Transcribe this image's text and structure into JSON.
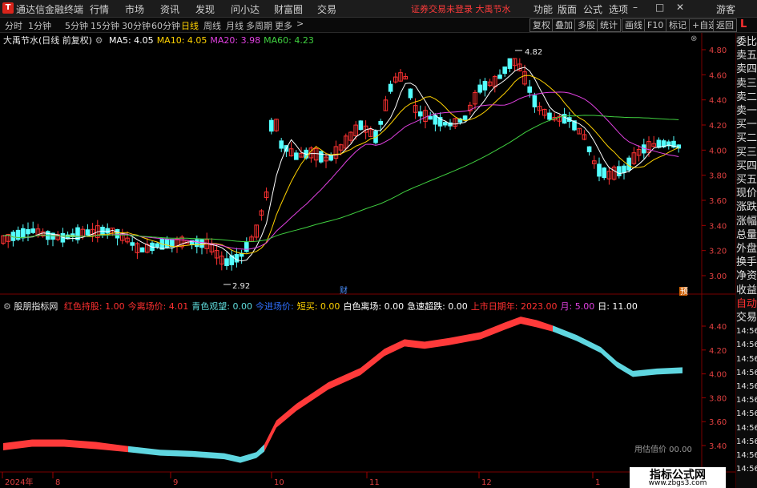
{
  "menubar": {
    "app_title": "通达信金融终端",
    "logo_glyph": "T",
    "items": [
      "行情",
      "市场",
      "资讯",
      "发现",
      "问小达",
      "财富圈",
      "交易"
    ],
    "notice": "证券交易未登录  大禹节水",
    "right_items": [
      "功能",
      "版面",
      "公式",
      "选项",
      "游客"
    ],
    "window_controls": [
      "minimize-icon",
      "maximize-icon",
      "close-icon"
    ]
  },
  "toolbar": {
    "periods": [
      "分时",
      "1分钟",
      "5分钟",
      "15分钟",
      "30分钟",
      "60分钟",
      "日线",
      "周线",
      "月线",
      "多周期",
      "更多"
    ],
    "active_period": "日线",
    "right_buttons": [
      "复权",
      "叠加",
      "多股",
      "统计",
      "画线",
      "F10",
      "标记",
      "+自选",
      "返回"
    ]
  },
  "main_chart": {
    "title": "大禹节水(日线 前复权)",
    "ma_legend": [
      {
        "label": "MA5: 4.05",
        "color": "#ffffff"
      },
      {
        "label": "MA10: 4.05",
        "color": "#ffd200"
      },
      {
        "label": "MA20: 3.98",
        "color": "#e040e0"
      },
      {
        "label": "MA60: 4.23",
        "color": "#40d040"
      }
    ],
    "y_ticks": [
      "4.80",
      "4.60",
      "4.40",
      "4.20",
      "4.00",
      "3.80",
      "3.60",
      "3.40",
      "3.20",
      "3.00"
    ],
    "high_label": "4.82",
    "low_label": "2.92",
    "event_marker": "财",
    "badge": "预"
  },
  "sub_chart": {
    "title": "股朋指标网",
    "legend": [
      {
        "label": "红色持股: 1.00",
        "color": "#ff3030"
      },
      {
        "label": "今离场价: 4.01",
        "color": "#ff3030"
      },
      {
        "label": "青色观望: 0.00",
        "color": "#5fdcdc"
      },
      {
        "label": "今进场价:",
        "color": "#3070ff"
      },
      {
        "label": "短买: 0.00",
        "color": "#ffd200"
      },
      {
        "label": "白色离场: 0.00",
        "color": "#ffffff"
      },
      {
        "label": "急速超跌: 0.00",
        "color": "#ffffff"
      },
      {
        "label": "上市日期年: 2023.00",
        "color": "#ff3030"
      },
      {
        "label": "月: 5.00",
        "color": "#e040e0"
      },
      {
        "label": "日: 11.00",
        "color": "#ffffff"
      }
    ],
    "y_ticks": [
      "4.40",
      "4.20",
      "4.00",
      "3.80",
      "3.60",
      "3.40"
    ],
    "footer_partial": "用估值价 00.00"
  },
  "date_axis": {
    "labels": [
      "2024年",
      "8",
      "9",
      "10",
      "11",
      "12",
      "1"
    ]
  },
  "sidebar": {
    "items": [
      {
        "label": "委比",
        "red": false
      },
      {
        "label": "卖五",
        "red": false
      },
      {
        "label": "卖四",
        "red": false
      },
      {
        "label": "卖三",
        "red": false
      },
      {
        "label": "卖二",
        "red": false
      },
      {
        "label": "卖一",
        "red": false
      },
      {
        "label": "买一",
        "red": false
      },
      {
        "label": "买二",
        "red": false
      },
      {
        "label": "买三",
        "red": false
      },
      {
        "label": "买四",
        "red": false
      },
      {
        "label": "买五",
        "red": false
      },
      {
        "label": "现价",
        "red": false
      },
      {
        "label": "涨跌",
        "red": false
      },
      {
        "label": "涨幅",
        "red": false
      },
      {
        "label": "总量",
        "red": false
      },
      {
        "label": "外盘",
        "red": false
      },
      {
        "label": "换手",
        "red": false
      },
      {
        "label": "净资",
        "red": false
      },
      {
        "label": "收益",
        "red": false
      },
      {
        "label": "自动",
        "red": true
      },
      {
        "label": "交易",
        "red": false
      },
      {
        "label": "14:56",
        "red": false
      },
      {
        "label": "14:56",
        "red": false
      },
      {
        "label": "14:56",
        "red": false
      },
      {
        "label": "14:56",
        "red": false
      },
      {
        "label": "14:56",
        "red": false
      },
      {
        "label": "14:56",
        "red": false
      },
      {
        "label": "14:56",
        "red": false
      },
      {
        "label": "14:56",
        "red": false
      },
      {
        "label": "14:56",
        "red": false
      },
      {
        "label": "14:56",
        "red": false
      },
      {
        "label": "14:56",
        "red": false
      }
    ],
    "top_letter": "L"
  },
  "watermark": {
    "title": "指标公式网",
    "url": "www.zbgs3.com"
  }
}
